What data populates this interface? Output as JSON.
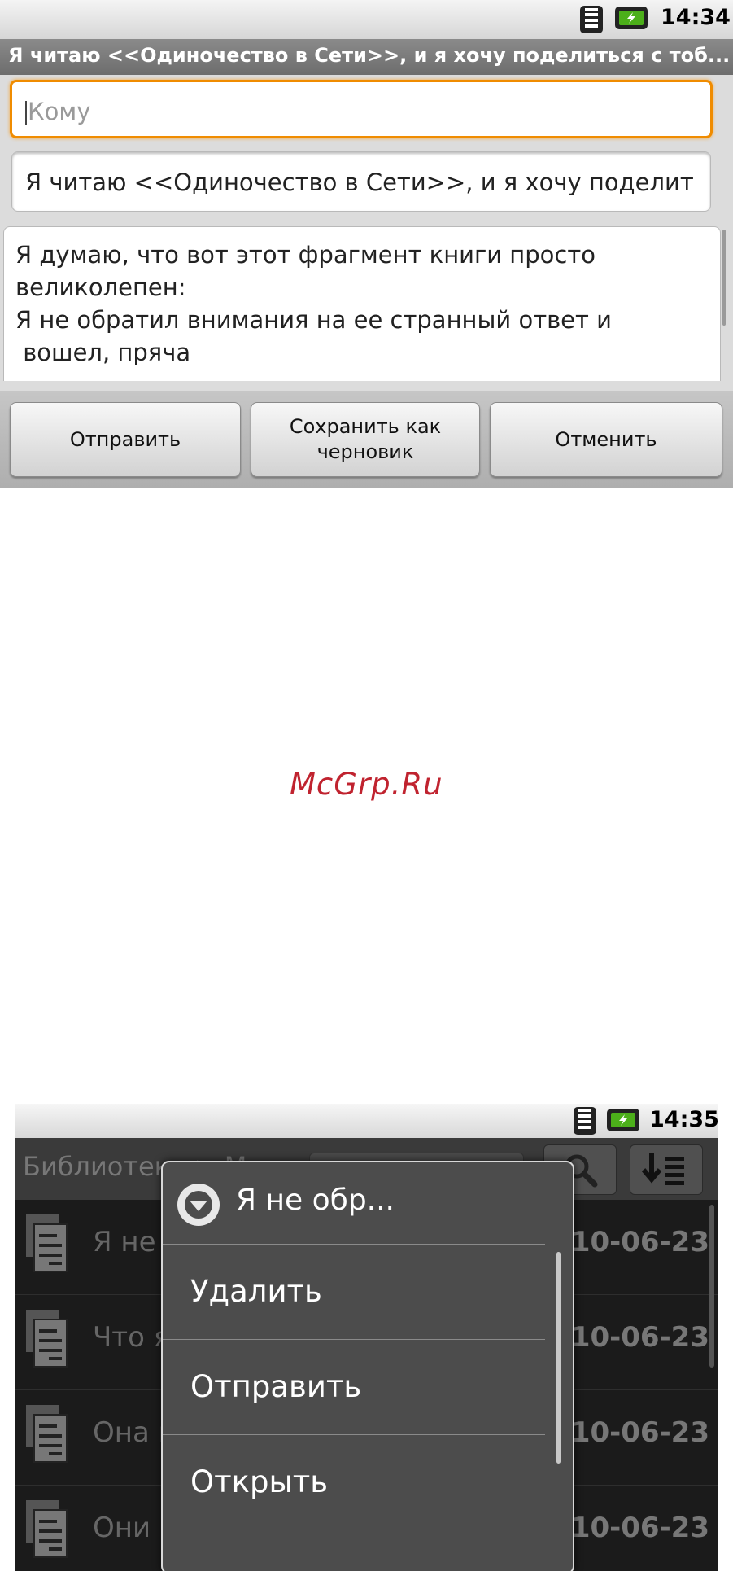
{
  "compose": {
    "status_time": "14:34",
    "title": "Я читаю <<Одиночество в Сети>>, и я хочу поделиться с тоб...",
    "to_placeholder": "Кому",
    "subject": "Я читаю <<Одиночество в Сети>>, и я хочу поделит",
    "body": "Я думаю, что вот этот фрагмент книги просто\nвеликолепен:\nЯ не обратил внимания на ее странный ответ и\n вошел, пряча",
    "buttons": {
      "send": "Отправить",
      "save_draft": "Сохранить как\nчерновик",
      "cancel": "Отменить"
    }
  },
  "watermark": "McGrp.Ru",
  "library": {
    "status_time": "14:35",
    "header_title": "Библиотека > Мар...",
    "rows": [
      {
        "title": "Я не обрат...",
        "date": "2010-06-23"
      },
      {
        "title": "Что я поду...",
        "date": "2010-06-23"
      },
      {
        "title": "Она не по...",
        "date": "2010-06-23"
      },
      {
        "title": "Они как ра...",
        "date": "2010-06-23"
      }
    ],
    "context_menu": {
      "title": "Я не обр...",
      "items": [
        "Удалить",
        "Отправить",
        "Открыть"
      ]
    }
  },
  "colors": {
    "focus_orange": "#f08c00",
    "watermark_red": "#c0232f",
    "battery_green": "#4caf1a"
  },
  "icons": [
    "wifi-icon",
    "battery-icon",
    "search-icon",
    "sort-icon",
    "document-icon",
    "chevron-down-icon"
  ]
}
